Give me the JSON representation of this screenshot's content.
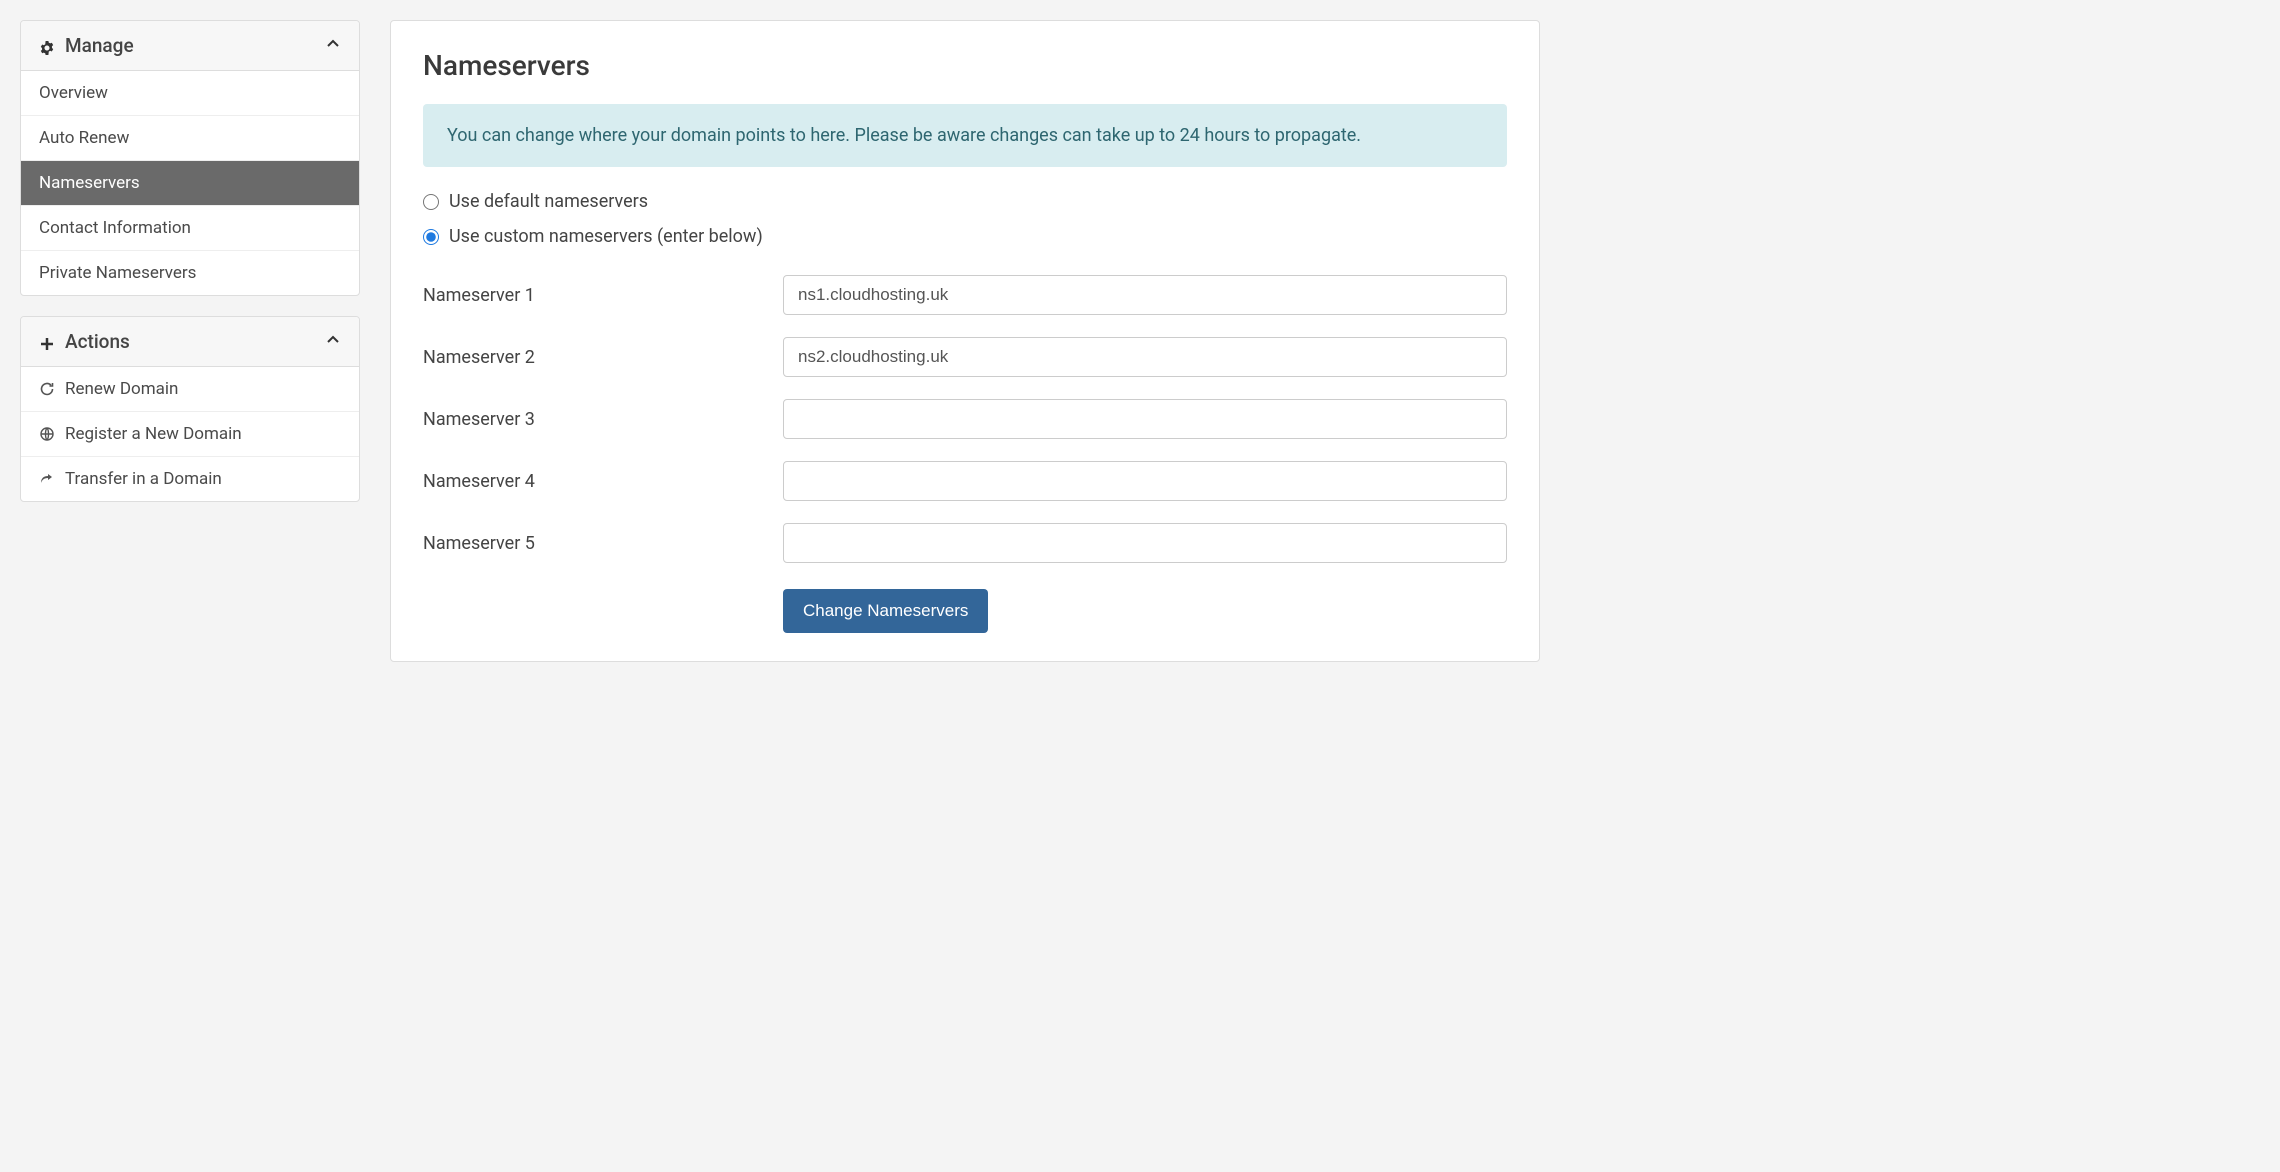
{
  "sidebar": {
    "manage": {
      "title": "Manage",
      "items": [
        {
          "label": "Overview",
          "active": false
        },
        {
          "label": "Auto Renew",
          "active": false
        },
        {
          "label": "Nameservers",
          "active": true
        },
        {
          "label": "Contact Information",
          "active": false
        },
        {
          "label": "Private Nameservers",
          "active": false
        }
      ]
    },
    "actions": {
      "title": "Actions",
      "items": [
        {
          "label": "Renew Domain",
          "icon": "refresh"
        },
        {
          "label": "Register a New Domain",
          "icon": "globe"
        },
        {
          "label": "Transfer in a Domain",
          "icon": "share"
        }
      ]
    }
  },
  "main": {
    "title": "Nameservers",
    "info": "You can change where your domain points to here. Please be aware changes can take up to 24 hours to propagate.",
    "radios": {
      "default": "Use default nameservers",
      "custom": "Use custom nameservers (enter below)"
    },
    "fields": [
      {
        "label": "Nameserver 1",
        "value": "ns1.cloudhosting.uk"
      },
      {
        "label": "Nameserver 2",
        "value": "ns2.cloudhosting.uk"
      },
      {
        "label": "Nameserver 3",
        "value": ""
      },
      {
        "label": "Nameserver 4",
        "value": ""
      },
      {
        "label": "Nameserver 5",
        "value": ""
      }
    ],
    "submit": "Change Nameservers"
  }
}
